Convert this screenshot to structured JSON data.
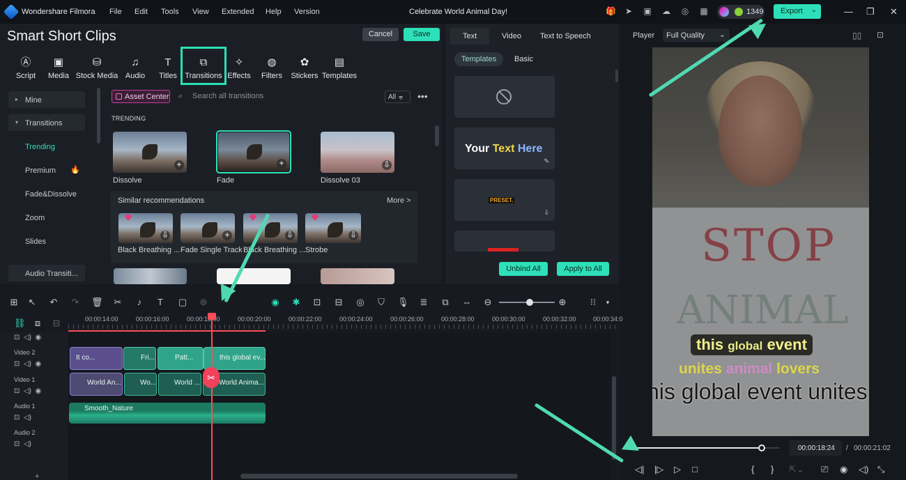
{
  "app": {
    "title": "Wondershare Filmora",
    "project_title": "Celebrate World Animal Day!",
    "credits": "1349",
    "export_label": "Export"
  },
  "menu": [
    "File",
    "Edit",
    "Tools",
    "View",
    "Extended",
    "Help",
    "Version"
  ],
  "header": {
    "title": "Smart Short Clips",
    "cancel": "Cancel",
    "save": "Save"
  },
  "toolbar": [
    "Script",
    "Media",
    "Stock Media",
    "Audio",
    "Titles",
    "Transitions",
    "Effects",
    "Filters",
    "Stickers",
    "Templates"
  ],
  "sidebar": {
    "mine": "Mine",
    "transitions": "Transitions",
    "items": [
      "Trending",
      "Premium",
      "Fade&Dissolve",
      "Zoom",
      "Slides"
    ],
    "audio": "Audio Transiti..."
  },
  "browser": {
    "asset_center": "Asset Center",
    "search_placeholder": "Search all transitions",
    "filter": "All",
    "section": "TRENDING",
    "trending": [
      "Dissolve",
      "Fade",
      "Dissolve 03"
    ],
    "similar_title": "Similar recommendations",
    "more": "More >",
    "similar": [
      "Black Breathing ...",
      "Fade Single Track",
      "Black Breathing ...",
      "Strobe"
    ]
  },
  "text_panel": {
    "tabs": [
      "Text",
      "Video",
      "Text to Speech"
    ],
    "subtabs": [
      "Templates",
      "Basic"
    ],
    "card_text_a": "Your ",
    "card_text_b": "Text",
    "card_text_c": " Here",
    "preset": "PRESET.",
    "unbind": "Unbind All",
    "apply": "Apply to All"
  },
  "player": {
    "label": "Player",
    "quality": "Full Quality",
    "current": "00:00:18:24",
    "total": "00:00:21:02",
    "sep": "/"
  },
  "video": {
    "stop": "STOP",
    "animal": "ANIMAL",
    "cap1_a": "this",
    "cap1_b": "global",
    "cap1_c": "event",
    "cap2_a": "unites",
    "cap2_b": "animal",
    "cap2_c": "lovers",
    "cap3": "his global event unites a"
  },
  "timeline": {
    "ruler": [
      "00:00:14:00",
      "00:00:16:00",
      "00:00:18:00",
      "00:00:20:00",
      "00:00:22:00",
      "00:00:24:00",
      "00:00:26:00",
      "00:00:28:00",
      "00:00:30:00",
      "00:00:32:00",
      "00:00:34:0"
    ],
    "tracks": [
      "Video 2",
      "Video 1",
      "Audio 1",
      "Audio 2"
    ],
    "text_clips": [
      "It co...",
      "Fri...",
      "Patt...",
      "this global ev..."
    ],
    "video_clips": [
      "World An...",
      "Wo...",
      "World ...",
      "World Anima..."
    ],
    "audio_clip": "Smooth_Nature"
  },
  "colors": {
    "accent": "#2de0b9",
    "playhead": "#ff4d58",
    "annotation": "#4fd9b3"
  }
}
